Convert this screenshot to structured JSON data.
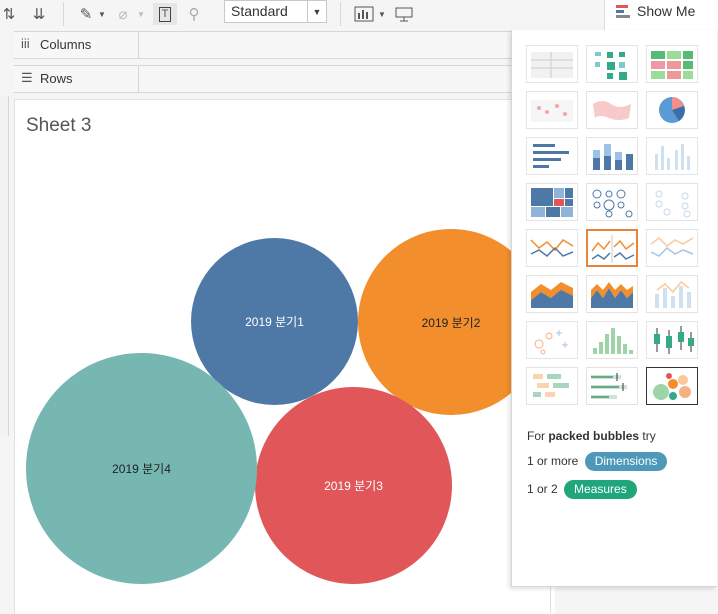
{
  "toolbar": {
    "fit_select": "Standard",
    "show_me_label": "Show Me",
    "icons": [
      "sort-ascending-icon",
      "sort-descending-icon",
      "highlight-icon",
      "paperclip-icon",
      "text-label-icon",
      "pin-icon",
      "chart-type-icon",
      "presentation-icon"
    ]
  },
  "shelves": {
    "columns_label": "Columns",
    "rows_label": "Rows"
  },
  "sheet": {
    "title": "Sheet 3",
    "bubbles": [
      {
        "label": "2019 분기1",
        "color": "#4e79a7"
      },
      {
        "label": "2019 분기2",
        "color": "#f28e2b"
      },
      {
        "label": "2019 분기3",
        "color": "#e15759"
      },
      {
        "label": "2019 분기4",
        "color": "#76b7b2"
      }
    ]
  },
  "show_me": {
    "hint_prefix": "For ",
    "hint_chart": "packed bubbles",
    "hint_suffix": " try",
    "dimensions_prefix": "1 or more",
    "dimensions_label": "Dimensions",
    "dimensions_color": "#4e98b8",
    "measures_prefix": "1 or 2",
    "measures_label": "Measures",
    "measures_color": "#1fa67a",
    "chart_types": [
      "text-table",
      "heat-map",
      "highlight-table",
      "symbol-map",
      "filled-map",
      "pie-chart",
      "horizontal-bars",
      "stacked-bars",
      "side-by-side-bars",
      "treemap",
      "circle-views",
      "side-by-side-circles",
      "continuous-lines",
      "discrete-lines",
      "dual-lines",
      "area-continuous",
      "area-discrete",
      "dual-combination",
      "scatter-plot",
      "histogram",
      "box-and-whisker",
      "gantt-chart",
      "bullet-graph",
      "packed-bubbles"
    ]
  }
}
